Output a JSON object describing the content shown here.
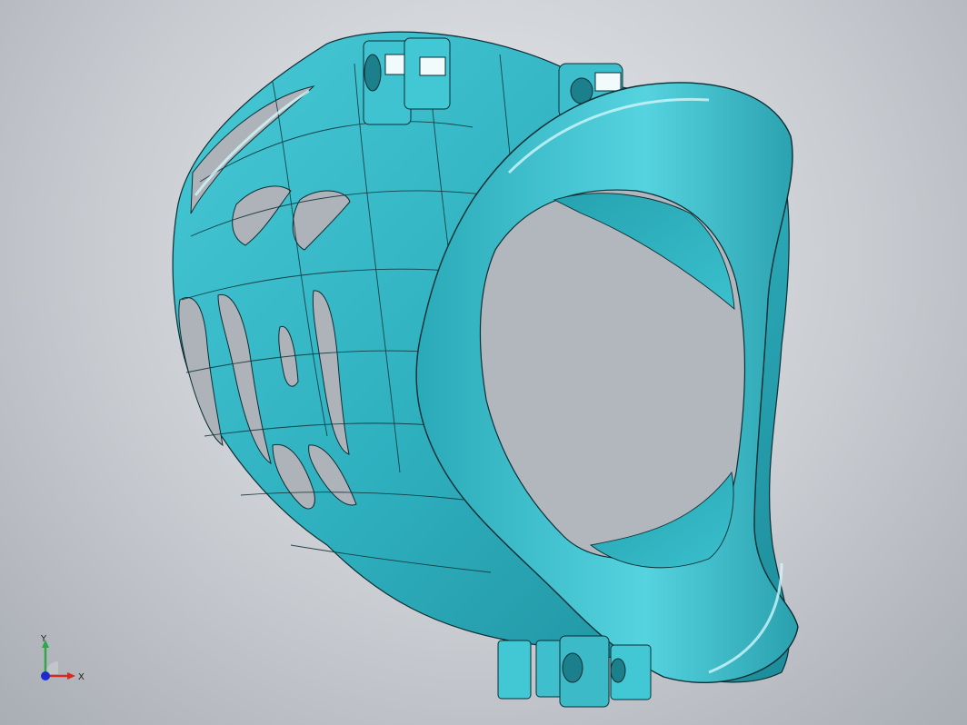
{
  "viewport": {
    "background_top": "#e7e9ec",
    "background_bottom": "#a9adb4"
  },
  "model": {
    "face_color": "#34b7c6",
    "face_dark": "#1f8f9e",
    "face_light": "#7fe3ee",
    "edge_color": "#0c2e33"
  },
  "triad": {
    "x_label": "X",
    "y_label": "Y",
    "x_color": "#d52a1e",
    "y_color": "#2fa84a",
    "z_color": "#1c2bd1"
  }
}
